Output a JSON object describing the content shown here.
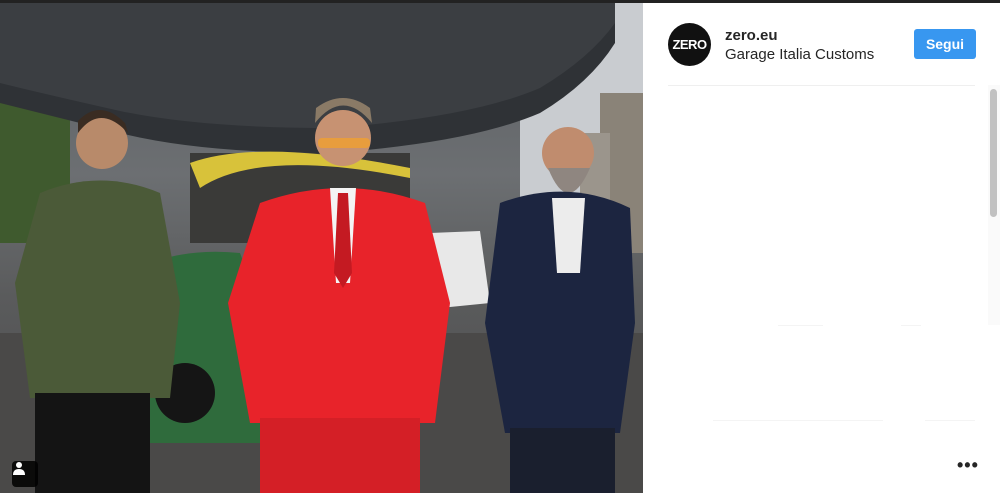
{
  "post": {
    "username": "zero.eu",
    "location": "Garage Italia Customs",
    "avatar_text": "ZERO",
    "follow_label": "Segui",
    "more_label": "•••",
    "photo_icon": "user-tag-icon",
    "colors": {
      "follow_button": "#3897f0",
      "avatar_bg": "#111111",
      "red_suit": "#e8232a",
      "green_coat": "#4b5a38",
      "navy_coat": "#1c2540"
    }
  }
}
